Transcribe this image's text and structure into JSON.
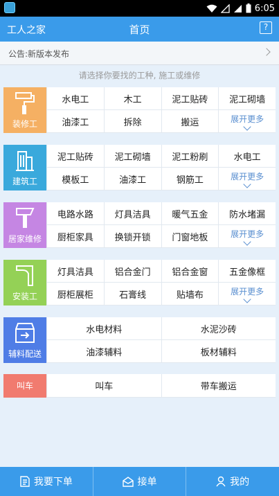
{
  "status": {
    "time": "6:05"
  },
  "header": {
    "app_name": "工人之家",
    "title": "首页",
    "help_glyph": "?"
  },
  "notice": {
    "text": "公告:新版本发布"
  },
  "prompt": "请选择你要找的工种, 施工或维修",
  "categories": [
    {
      "label": "装修工",
      "color": "#f5b063",
      "items": [
        "水电工",
        "木工",
        "泥工贴砖",
        "泥工砌墙",
        "油漆工",
        "拆除",
        "搬运"
      ],
      "more": "展开更多"
    },
    {
      "label": "建筑工",
      "color": "#3aa9dc",
      "items": [
        "泥工贴砖",
        "泥工砌墙",
        "泥工粉刷",
        "水电工",
        "模板工",
        "油漆工",
        "钢筋工"
      ],
      "more": "展开更多"
    },
    {
      "label": "居家维修",
      "color": "#c586e3",
      "items": [
        "电路水路",
        "灯具洁具",
        "暖气五金",
        "防水堵漏",
        "厨柜家具",
        "换锁开锁",
        "门窗地板"
      ],
      "more": "展开更多"
    },
    {
      "label": "安装工",
      "color": "#94d156",
      "items": [
        "灯具洁具",
        "铝合金门",
        "铝合金窗",
        "五金像框",
        "厨柜展柜",
        "石膏线",
        "贴墙布"
      ],
      "more": "展开更多"
    },
    {
      "label": "辅料配送",
      "color": "#4f7de6",
      "items": [
        "水电材料",
        "水泥沙砖",
        "油漆辅料",
        "板材辅料"
      ]
    },
    {
      "label": "叫车",
      "color": "#f17b6f",
      "items": [
        "叫车",
        "带车搬运"
      ]
    }
  ],
  "tabs": [
    {
      "label": "我要下单",
      "icon": "document-icon"
    },
    {
      "label": "接单",
      "icon": "inbox-icon"
    },
    {
      "label": "我的",
      "icon": "user-icon"
    }
  ]
}
